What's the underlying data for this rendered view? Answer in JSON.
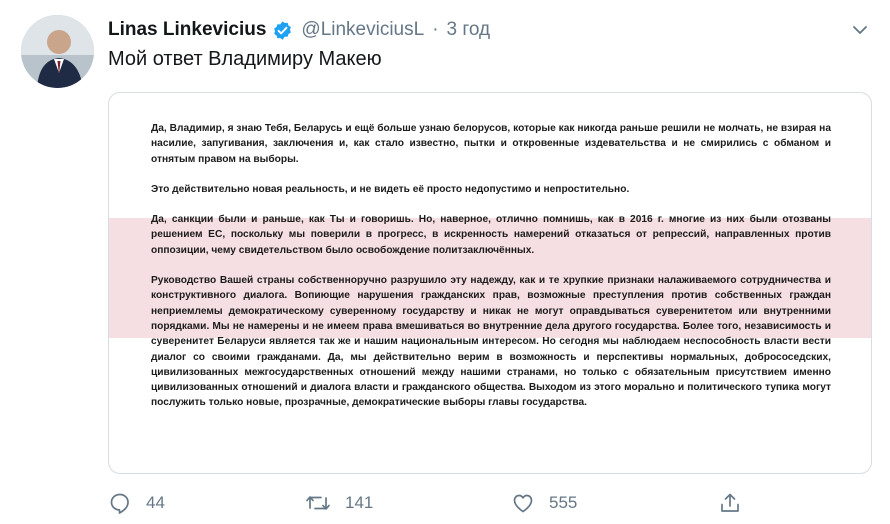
{
  "tweet": {
    "author_name": "Linas Linkevicius",
    "handle": "@LinkeviciusL",
    "separator": "·",
    "time": "3 год",
    "text": "Мой ответ Владимиру Макею"
  },
  "document": {
    "paragraphs": [
      "Да, Владимир, я знаю Тебя, Беларусь и ещё больше узнаю белорусов, которые как никогда раньше решили не молчать, не взирая на насилие, запугивания, заключения и, как стало известно, пытки и откровенные издевательства и не смирились с обманом и отнятым правом на выборы.",
      "Это действительно новая реальность, и не видеть её просто недопустимо и непростительно.",
      "Да, санкции были и раньше, как Ты и говоришь. Но, наверное, отлично помнишь, как в 2016 г. многие из них были отозваны решением ЕС, поскольку мы поверили в прогресс, в искренность намерений отказаться от репрессий, направленных против оппозиции, чему свидетельством было освобождение политзаключённых.",
      "Руководство Вашей страны собственноручно разрушило эту надежду, как и те хрупкие признаки налаживаемого сотрудничества и конструктивного диалога. Вопиющие нарушения гражданских прав, возможные преступления против собственных граждан неприемлемы демократическому суверенному государству и никак не могут оправдываться суверенитетом или внутренними порядками. Мы не намерены и не имеем права вмешиваться во внутренние дела другого государства. Более того, независимость и суверенитет Беларуси является так же и нашим национальным интересом. Но сегодня мы наблюдаем неспособность власти вести диалог со своими гражданами. Да, мы действительно верим в возможность и перспективы нормальных, добрососедских, цивилизованных межгосударственных отношений между нашими странами, но только с обязательным присутствием именно цивилизованных отношений и диалога власти и гражданского общества. Выходом из этого морально и политического тупика могут послужить только новые, прозрачные, демократические выборы главы государства."
    ]
  },
  "actions": {
    "reply_count": "44",
    "retweet_count": "141",
    "like_count": "555"
  },
  "icons": {
    "verified": "verified-badge-icon",
    "menu": "chevron-down-icon",
    "reply": "reply-icon",
    "retweet": "retweet-icon",
    "like": "heart-icon",
    "share": "share-icon"
  },
  "colors": {
    "accent": "#1da1f2",
    "muted": "#657786",
    "highlight_band": "#f6dfe2"
  }
}
